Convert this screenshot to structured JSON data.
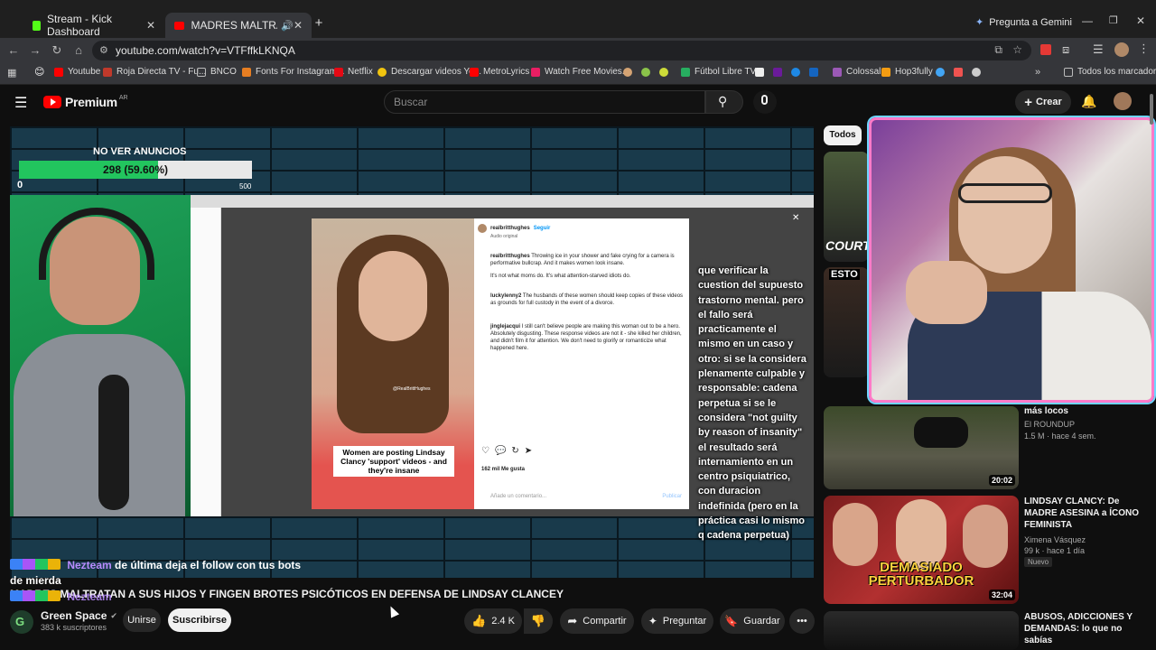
{
  "browser": {
    "tabs": [
      {
        "title": "Stream - Kick Dashboard",
        "active": false
      },
      {
        "title": "MADRES MALTRATAN A SU",
        "active": true
      }
    ],
    "gemini_label": "Pregunta a Gemini",
    "url": "youtube.com/watch?v=VTFffkLKNQA",
    "bookmarks": [
      {
        "label": "Youtube",
        "color": "#ff0000"
      },
      {
        "label": "Roja Directa TV - Fu...",
        "color": "#c0392b"
      },
      {
        "label": "BNCO",
        "color": "#888888"
      },
      {
        "label": "Fonts For Instagram...",
        "color": "#e67e22"
      },
      {
        "label": "Netflix",
        "color": "#e50914"
      },
      {
        "label": "Descargar videos Yo...",
        "color": "#f1c40f"
      },
      {
        "label": "MetroLyrics",
        "color": "#ff0000"
      },
      {
        "label": "Watch Free Movies...",
        "color": "#e91e63"
      },
      {
        "label": "Fútbol Libre TV",
        "color": "#27ae60"
      },
      {
        "label": "Colossal",
        "color": "#9b59b6"
      },
      {
        "label": "Hop3fully",
        "color": "#f39c12"
      }
    ],
    "all_bookmarks_label": "Todos los marcadores"
  },
  "youtube": {
    "logo_text": "Premium",
    "logo_region": "AR",
    "search_placeholder": "Buscar",
    "create_label": "Crear",
    "filter_chip": "Todos"
  },
  "video": {
    "overlay_goal_label": "NO VER ANUNCIOS",
    "overlay_goal_value": "298 (59.60%)",
    "overlay_goal_progress": 0.596,
    "overlay_goal_min": "0",
    "overlay_goal_max": "500",
    "ig_user": "realbritthughes",
    "ig_follow": "Seguir",
    "ig_audio": "Audio original",
    "ig_comments": [
      {
        "user": "realbritthughes",
        "text": "Throwing ice in your shower and fake crying for a camera is performative bullcrap. And it makes women look insane."
      },
      {
        "user": "",
        "text": "It's not what moms do. It's what attention-starved idiots do."
      },
      {
        "user": "luckylenny2",
        "text": "The husbands of these women should keep copies of these videos as grounds for full custody in the event of a divorce."
      },
      {
        "user": "jinglejacqui",
        "text": "I still can't believe people are making this woman out to be a hero. Absolutely disgusting. These response videos are not it - she killed her children, and didn't film it for attention. We don't need to glorify or romanticize what happened here."
      }
    ],
    "ig_likes": "162 mil Me gusta",
    "ig_comment_placeholder": "Añade un comentario...",
    "ig_publish": "Publicar",
    "photo_caption": "Women are posting Lindsay Clancy 'support' videos - and they're insane",
    "photo_tag": "@RealBrittHughes",
    "subtitle_lines": [
      "que verificar la",
      "cuestion del supuesto",
      "trastorno mental. pero",
      "el fallo será",
      "practicamente el",
      "mismo en un caso y",
      "otro: si se la considera",
      "plenamente culpable y",
      "responsable: cadena",
      "perpetua si se le",
      "considera \"not guilty",
      "by reason of insanity\"",
      "el resultado será",
      "internamiento en un",
      "centro psiquiatrico,",
      "con duracion",
      "indefinida (pero en la",
      "práctica casi lo mismo",
      "q cadena perpetua)"
    ]
  },
  "chat": [
    {
      "user": "Nezteam",
      "text": "de última deja el follow con tus bots de mierda"
    },
    {
      "user": "Nezteam",
      "text": ""
    }
  ],
  "title": "MADRES MALTRATAN A SUS HIJOS Y FINGEN BROTES PSICÓTICOS EN DEFENSA DE LINDSAY CLANCEY",
  "channel": {
    "name": "Green Space",
    "subscribers": "383 k suscriptores",
    "join_label": "Unirse",
    "subscribe_label": "Suscribirse"
  },
  "actions": {
    "likes": "2.4 K",
    "share": "Compartir",
    "ask": "Preguntar",
    "save": "Guardar"
  },
  "recommendations": [
    {
      "title": "más locos",
      "channel": "El ROUNDUP",
      "meta": "1.5 M · hace 4 sem.",
      "duration": "20:02",
      "badge": ""
    },
    {
      "title": "LINDSAY CLANCY: De MADRE ASESINA a ÍCONO FEMINISTA",
      "channel": "Ximena Vásquez",
      "meta": "99 k · hace 1 día",
      "duration": "32:04",
      "badge": "Nuevo",
      "thumb_text": "DEMASIADO PERTURBADOR"
    },
    {
      "title": "ABUSOS, ADICCIONES Y DEMANDAS: lo que no sabías",
      "channel": "",
      "meta": "",
      "duration": "",
      "badge": ""
    }
  ],
  "partial_thumbs": [
    "COURT",
    "ESTO"
  ],
  "colors": {
    "accent_red": "#ff0000",
    "goal_green": "#22c55e",
    "webcam_border": "#ff7ac8",
    "chat_user": "#b98cff"
  }
}
